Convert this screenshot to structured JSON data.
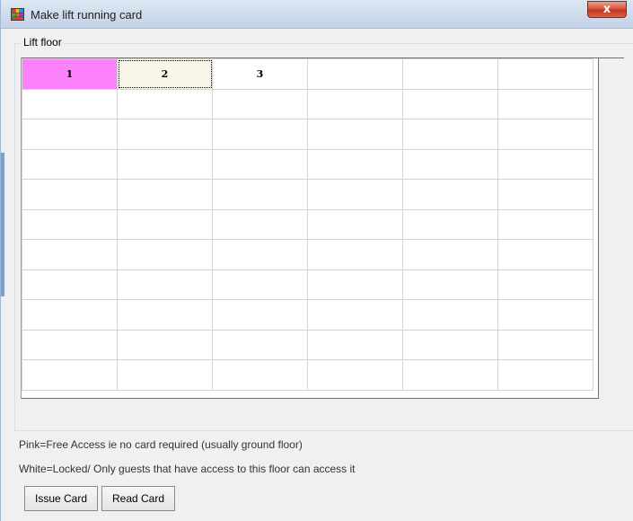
{
  "window": {
    "title": "Make lift running card",
    "close_label": "x"
  },
  "group": {
    "legend": "Lift floor"
  },
  "grid": {
    "columns": 6,
    "header_cells": [
      "1",
      "2",
      "3",
      "",
      "",
      ""
    ],
    "empty_rows": 10,
    "colors": {
      "free_access": "#fb82fa",
      "selected": "#f8f6e8",
      "locked": "#ffffff"
    }
  },
  "legend_notes": {
    "pink": "Pink=Free Access ie no card required (usually ground floor)",
    "white": "White=Locked/ Only guests that have access to this floor can access it"
  },
  "buttons": {
    "issue": "Issue Card",
    "read": "Read Card"
  }
}
